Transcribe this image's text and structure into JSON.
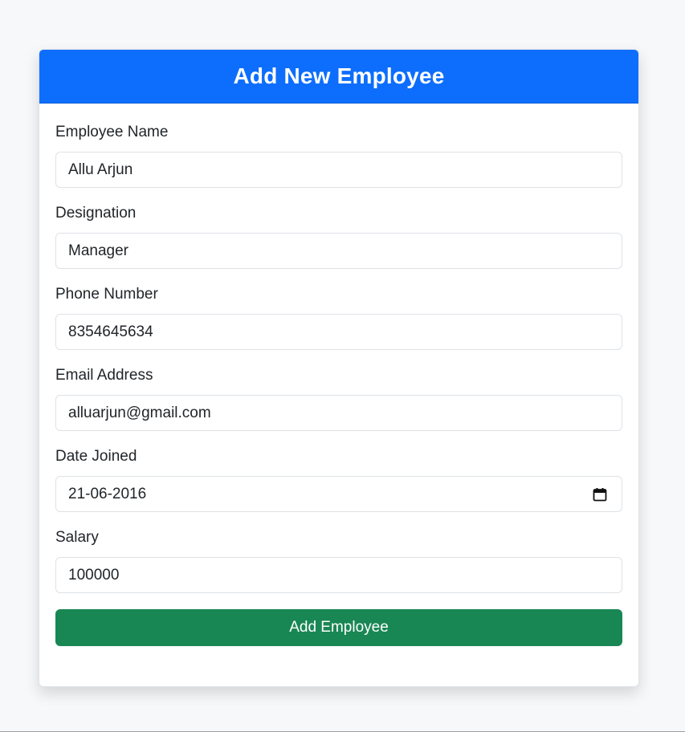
{
  "form": {
    "title": "Add New Employee",
    "fields": [
      {
        "label": "Employee Name",
        "value": "Allu Arjun"
      },
      {
        "label": "Designation",
        "value": "Manager"
      },
      {
        "label": "Phone Number",
        "value": "8354645634"
      },
      {
        "label": "Email Address",
        "value": "alluarjun@gmail.com"
      },
      {
        "label": "Date Joined",
        "value": "21-06-2016",
        "icon": "calendar-icon"
      },
      {
        "label": "Salary",
        "value": "100000"
      }
    ],
    "submit_label": "Add Employee"
  },
  "colors": {
    "header": "#0d6efd",
    "submit": "#198754",
    "background": "#f7f8fa"
  }
}
